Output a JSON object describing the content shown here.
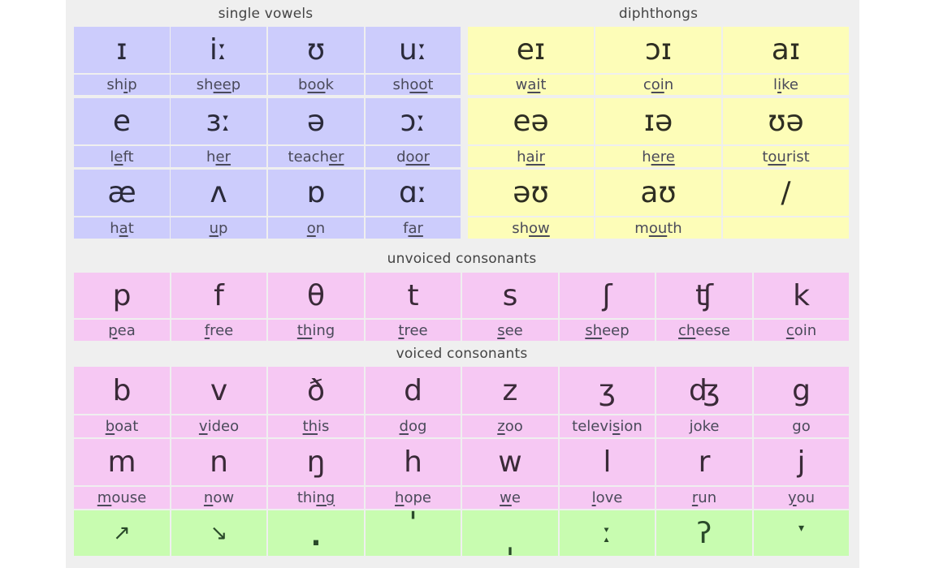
{
  "headers": {
    "single_vowels": "single vowels",
    "diphthongs": "diphthongs",
    "unvoiced": "unvoiced consonants",
    "voiced": "voiced consonants"
  },
  "colors": {
    "vowels": "#ccccfc",
    "diphthongs": "#fdfdb8",
    "consonants": "#f6c8f3",
    "intonation": "#c8fcb0",
    "panel": "#efefef"
  },
  "single_vowels": [
    [
      {
        "symbol": "ɪ",
        "word": [
          "sh",
          "i",
          "p"
        ]
      },
      {
        "symbol": "iː",
        "word": [
          "sh",
          "ee",
          "p"
        ]
      },
      {
        "symbol": "ʊ",
        "word": [
          "b",
          "oo",
          "k"
        ]
      },
      {
        "symbol": "uː",
        "word": [
          "sh",
          "oo",
          "t"
        ]
      }
    ],
    [
      {
        "symbol": "e",
        "word": [
          "l",
          "e",
          "ft"
        ]
      },
      {
        "symbol": "ɜː",
        "word": [
          "h",
          "er",
          ""
        ]
      },
      {
        "symbol": "ə",
        "word": [
          "teach",
          "er",
          ""
        ]
      },
      {
        "symbol": "ɔː",
        "word": [
          "d",
          "oor",
          ""
        ]
      }
    ],
    [
      {
        "symbol": "æ",
        "word": [
          "h",
          "a",
          "t"
        ]
      },
      {
        "symbol": "ʌ",
        "word": [
          "",
          "u",
          "p"
        ]
      },
      {
        "symbol": "ɒ",
        "word": [
          "",
          "o",
          "n"
        ]
      },
      {
        "symbol": "ɑː",
        "word": [
          "f",
          "ar",
          ""
        ]
      }
    ]
  ],
  "diphthongs": [
    [
      {
        "symbol": "eɪ",
        "word": [
          "w",
          "ai",
          "t"
        ]
      },
      {
        "symbol": "ɔɪ",
        "word": [
          "c",
          "oi",
          "n"
        ]
      },
      {
        "symbol": "aɪ",
        "word": [
          "l",
          "i",
          "ke"
        ]
      }
    ],
    [
      {
        "symbol": "eə",
        "word": [
          "h",
          "air",
          ""
        ]
      },
      {
        "symbol": "ɪə",
        "word": [
          "h",
          "ere",
          ""
        ]
      },
      {
        "symbol": "ʊə",
        "word": [
          "t",
          "ou",
          "rist"
        ]
      }
    ],
    [
      {
        "symbol": "əʊ",
        "word": [
          "sh",
          "ow",
          ""
        ]
      },
      {
        "symbol": "aʊ",
        "word": [
          "m",
          "ou",
          "th"
        ]
      },
      {
        "symbol": "/",
        "word": [
          "",
          "",
          ""
        ]
      }
    ]
  ],
  "unvoiced_consonants": [
    {
      "symbol": "p",
      "word": [
        "",
        "p",
        "ea"
      ]
    },
    {
      "symbol": "f",
      "word": [
        "",
        "f",
        "ree"
      ]
    },
    {
      "symbol": "θ",
      "word": [
        "",
        "th",
        "ing"
      ]
    },
    {
      "symbol": "t",
      "word": [
        "",
        "t",
        "ree"
      ]
    },
    {
      "symbol": "s",
      "word": [
        "",
        "s",
        "ee"
      ]
    },
    {
      "symbol": "ʃ",
      "word": [
        "",
        "sh",
        "eep"
      ]
    },
    {
      "symbol": "ʧ",
      "word": [
        "",
        "ch",
        "eese"
      ]
    },
    {
      "symbol": "k",
      "word": [
        "",
        "c",
        "oin"
      ]
    }
  ],
  "voiced_consonants": [
    [
      {
        "symbol": "b",
        "word": [
          "",
          "b",
          "oat"
        ]
      },
      {
        "symbol": "v",
        "word": [
          "",
          "v",
          "ideo"
        ]
      },
      {
        "symbol": "ð",
        "word": [
          "",
          "th",
          "is"
        ]
      },
      {
        "symbol": "d",
        "word": [
          "",
          "d",
          "og"
        ]
      },
      {
        "symbol": "z",
        "word": [
          "",
          "z",
          "oo"
        ]
      },
      {
        "symbol": "ʒ",
        "word": [
          "televi",
          "s",
          "ion"
        ]
      },
      {
        "symbol": "ʤ",
        "word": [
          "joke",
          "",
          ""
        ]
      },
      {
        "symbol": "g",
        "word": [
          "go",
          "",
          ""
        ]
      }
    ],
    [
      {
        "symbol": "m",
        "word": [
          "",
          "m",
          "ouse"
        ]
      },
      {
        "symbol": "n",
        "word": [
          "",
          "n",
          "ow"
        ]
      },
      {
        "symbol": "ŋ",
        "word": [
          "thi",
          "ng",
          ""
        ]
      },
      {
        "symbol": "h",
        "word": [
          "",
          "h",
          "ope"
        ]
      },
      {
        "symbol": "w",
        "word": [
          "",
          "w",
          "e"
        ]
      },
      {
        "symbol": "l",
        "word": [
          "",
          "l",
          "ove"
        ]
      },
      {
        "symbol": "r",
        "word": [
          "",
          "r",
          "un"
        ]
      },
      {
        "symbol": "j",
        "word": [
          "",
          "y",
          "ou"
        ]
      }
    ]
  ],
  "intonation_marks": [
    {
      "name": "rising-arrow",
      "symbol": "↗",
      "pos": "mid"
    },
    {
      "name": "falling-arrow",
      "symbol": "↘",
      "pos": "mid"
    },
    {
      "name": "syllable-break",
      "symbol": ".",
      "pos": "low"
    },
    {
      "name": "primary-stress",
      "symbol": "ˈ",
      "pos": "high"
    },
    {
      "name": "secondary-stress",
      "symbol": "ˌ",
      "pos": "low"
    },
    {
      "name": "length-mark",
      "symbol": "ː",
      "pos": "mid"
    },
    {
      "name": "glottal-stop",
      "symbol": "ʔ",
      "pos": "mid"
    },
    {
      "name": "linking-mark",
      "symbol": "▾",
      "pos": "high"
    }
  ]
}
